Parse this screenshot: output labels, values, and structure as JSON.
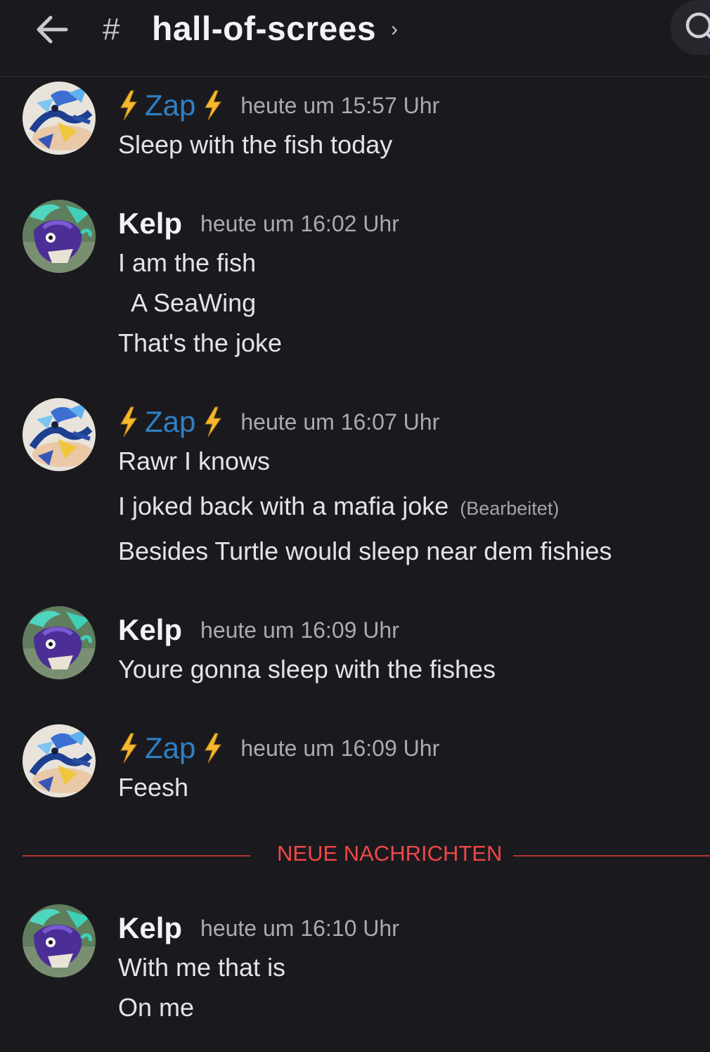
{
  "header": {
    "channel_prefix": "#",
    "channel_name": "hall-of-screes",
    "chevron": "›"
  },
  "messages": [
    {
      "author": "Zap",
      "author_style": "zap",
      "timestamp": "heute um 15:57 Uhr",
      "lines": [
        "Sleep with the fish today"
      ]
    },
    {
      "author": "Kelp",
      "author_style": "kelp",
      "timestamp": "heute um 16:02 Uhr",
      "lines": [
        "I am the fish",
        "  A SeaWing",
        "That's the joke"
      ]
    },
    {
      "author": "Zap",
      "author_style": "zap",
      "timestamp": "heute um 16:07 Uhr",
      "lines": [
        "Rawr I knows",
        "I joked back with a mafia joke",
        "Besides Turtle would sleep near dem fishies"
      ],
      "edited_label": "(Bearbeitet)"
    },
    {
      "author": "Kelp",
      "author_style": "kelp",
      "timestamp": "heute um 16:09 Uhr",
      "lines": [
        "Youre gonna sleep with the fishes"
      ]
    },
    {
      "author": "Zap",
      "author_style": "zap",
      "timestamp": "heute um 16:09 Uhr",
      "lines": [
        "Feesh"
      ]
    },
    {
      "author": "Kelp",
      "author_style": "kelp",
      "timestamp": "heute um 16:10 Uhr",
      "lines": [
        "With me that is",
        "On me"
      ]
    }
  ],
  "divider": {
    "label": "NEUE NACHRICHTEN"
  },
  "colors": {
    "background": "#1a1a1e",
    "zap_name": "#2f80c4",
    "bolt": "#f5b82e",
    "new_messages": "#f04747"
  },
  "icons": {
    "back": "arrow-left-icon",
    "search": "search-icon",
    "bolt": "lightning-bolt-emoji"
  }
}
